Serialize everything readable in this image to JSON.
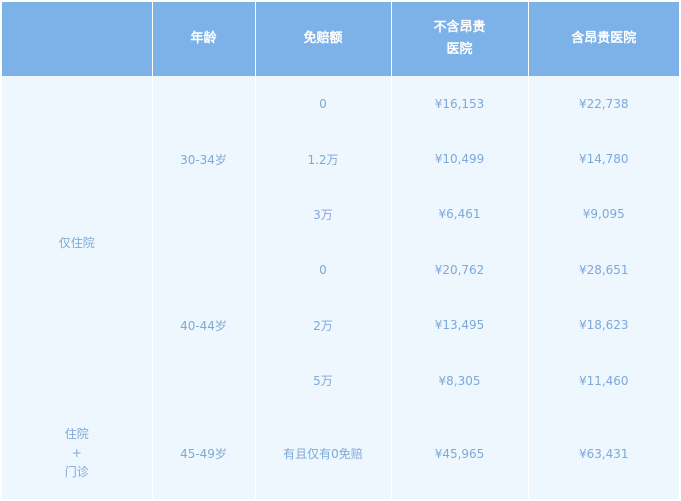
{
  "header": {
    "col0": "",
    "col1": "年龄",
    "col2": "免赔额",
    "col3_line1": "不含昂贵",
    "col3_line2": "医院",
    "col4": "含昂贵医院"
  },
  "rows": [
    {
      "plan": "仅住院",
      "age": "30-34岁",
      "deductible": "0",
      "excl": "¥16,153",
      "incl": "¥22,738"
    },
    {
      "deductible": "1.2万",
      "excl": "¥10,499",
      "incl": "¥14,780"
    },
    {
      "deductible": "3万",
      "excl": "¥6,461",
      "incl": "¥9,095"
    },
    {
      "age": "40-44岁",
      "deductible": "0",
      "excl": "¥20,762",
      "incl": "¥28,651"
    },
    {
      "deductible": "2万",
      "excl": "¥13,495",
      "incl": "¥18,623"
    },
    {
      "deductible": "5万",
      "excl": "¥8,305",
      "incl": "¥11,460"
    },
    {
      "plan_line1": "住院",
      "plan_line2": "+",
      "plan_line3": "门诊",
      "age": "45-49岁",
      "deductible": "有且仅有0免赔",
      "excl": "¥45,965",
      "incl": "¥63,431"
    }
  ]
}
